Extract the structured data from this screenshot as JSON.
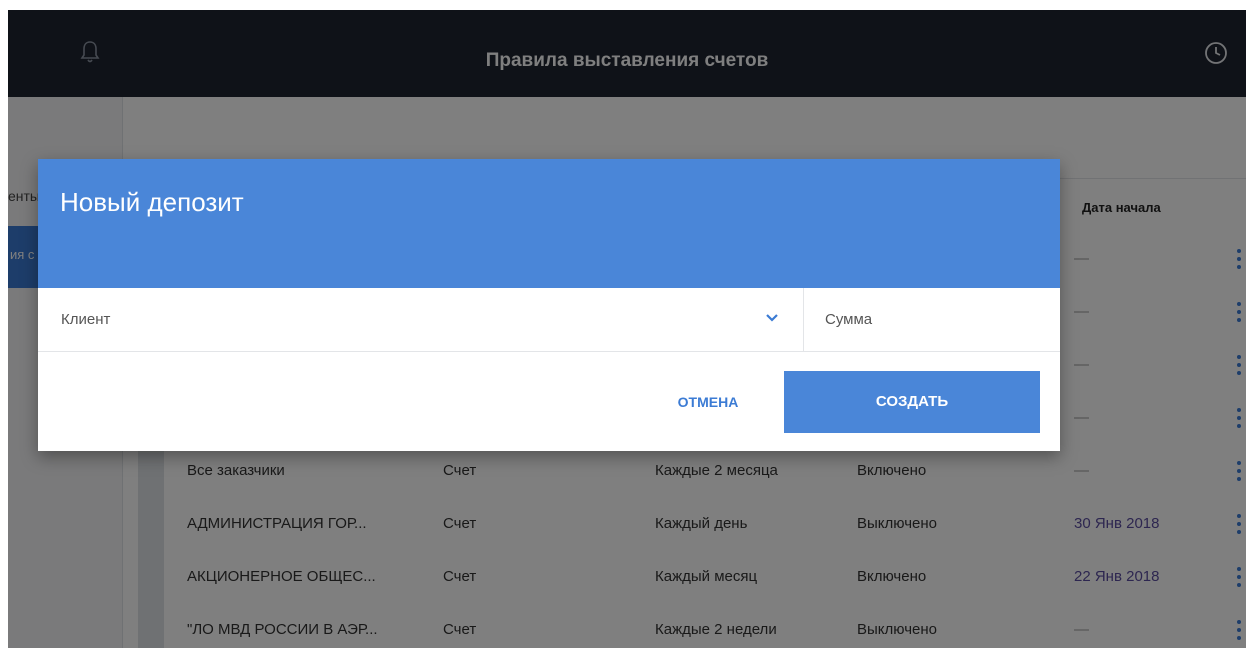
{
  "header": {
    "title": "Правила выставления счетов",
    "left_icon": "bell-icon",
    "right_icon": "clock-icon"
  },
  "sidebar": {
    "partial_label": "енты",
    "active_item_partial": "ия с"
  },
  "table": {
    "visible_header": "Дата начала",
    "rows": [
      {
        "name": "",
        "type": "",
        "period": "",
        "status": "",
        "date": "—"
      },
      {
        "name": "",
        "type": "",
        "period": "",
        "status": "",
        "date": "—"
      },
      {
        "name": "",
        "type": "",
        "period": "",
        "status": "",
        "date": "—"
      },
      {
        "name": "",
        "type": "",
        "period": "",
        "status": "",
        "date": "—"
      },
      {
        "name": "Все заказчики",
        "type": "Счет",
        "period": "Каждые 2 месяца",
        "status": "Включено",
        "date": "—"
      },
      {
        "name": "АДМИНИСТРАЦИЯ ГОР...",
        "type": "Счет",
        "period": "Каждый день",
        "status": "Выключено",
        "date": "30 Янв 2018"
      },
      {
        "name": "АКЦИОНЕРНОЕ ОБЩЕС...",
        "type": "Счет",
        "period": "Каждый месяц",
        "status": "Включено",
        "date": "22 Янв 2018"
      },
      {
        "name": "\"ЛО МВД РОССИИ В АЭР...",
        "type": "Счет",
        "period": "Каждые 2 недели",
        "status": "Выключено",
        "date": "—"
      }
    ]
  },
  "dialog": {
    "title": "Новый депозит",
    "client_label": "Клиент",
    "amount_label": "Сумма",
    "cancel_label": "ОТМЕНА",
    "create_label": "СОЗДАТЬ"
  },
  "colors": {
    "topbar": "#1e2530",
    "accent": "#4a86d8",
    "date_text": "#5b4da0"
  }
}
